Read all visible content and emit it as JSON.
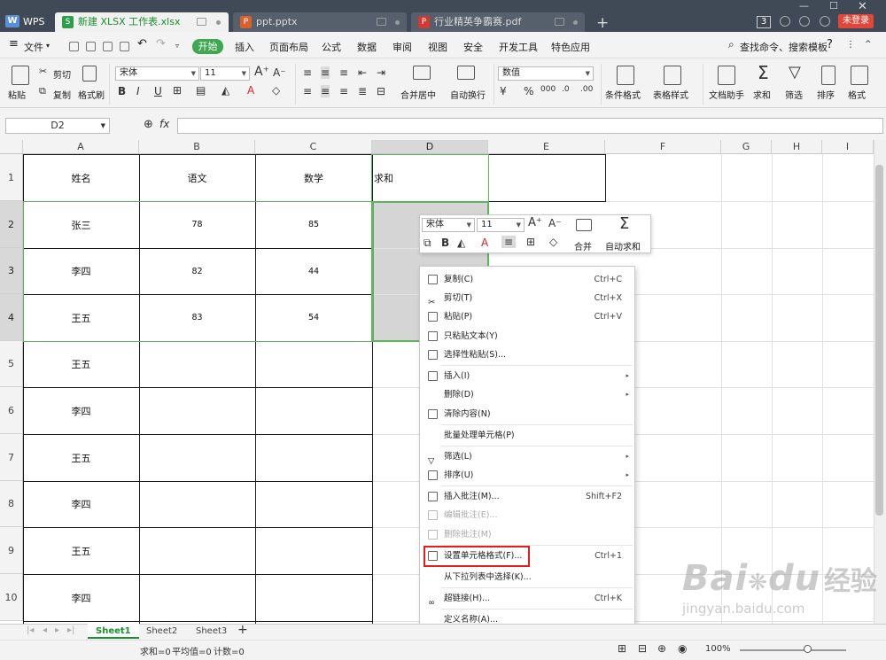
{
  "app": {
    "logo": "WPS",
    "tabs": [
      {
        "label": "新建 XLSX 工作表.xlsx",
        "active": true,
        "icon": "S"
      },
      {
        "label": "ppt.pptx",
        "active": false,
        "icon": "P"
      },
      {
        "label": "行业精英争霸赛.pdf",
        "active": false,
        "icon": "P"
      }
    ],
    "window_count": "3",
    "login_label": "未登录"
  },
  "menubar": {
    "file_label": "文件",
    "start_label": "开始",
    "items": [
      "插入",
      "页面布局",
      "公式",
      "数据",
      "审阅",
      "视图",
      "安全",
      "开发工具",
      "特色应用"
    ],
    "search_label": "查找命令、搜索模板",
    "help_label": "?"
  },
  "ribbon": {
    "paste": "粘贴",
    "cut": "剪切",
    "copy": "复制",
    "format_painter": "格式刷",
    "font_name": "宋体",
    "font_size": "11",
    "merge_center": "合并居中",
    "wrap_text": "自动换行",
    "number_format": "数值",
    "conditional_format": "条件格式",
    "table_style": "表格样式",
    "doc_helper": "文档助手",
    "sum": "求和",
    "filter": "筛选",
    "sort": "排序",
    "format": "格式"
  },
  "formula_bar": {
    "name_box": "D2",
    "fx": "fx",
    "value": ""
  },
  "columns": [
    "A",
    "B",
    "C",
    "D",
    "E",
    "F",
    "G",
    "H",
    "I"
  ],
  "rows": [
    "1",
    "2",
    "3",
    "4",
    "5",
    "6",
    "7",
    "8",
    "9",
    "10"
  ],
  "cells": {
    "A1": "姓名",
    "B1": "语文",
    "C1": "数学",
    "D1": "求和",
    "A2": "张三",
    "B2": "78",
    "C2": "85",
    "A3": "李四",
    "B3": "82",
    "C3": "44",
    "A4": "王五",
    "B4": "83",
    "C4": "54",
    "A5": "王五",
    "A6": "李四",
    "A7": "王五",
    "A8": "李四",
    "A9": "王五",
    "A10": "李四"
  },
  "mini_toolbar": {
    "font_name": "宋体",
    "font_size": "11",
    "merge": "合并",
    "autosum": "自动求和"
  },
  "context_menu": [
    {
      "label": "复制(C)",
      "shortcut": "Ctrl+C"
    },
    {
      "label": "剪切(T)",
      "shortcut": "Ctrl+X"
    },
    {
      "label": "粘贴(P)",
      "shortcut": "Ctrl+V"
    },
    {
      "label": "只粘贴文本(Y)",
      "shortcut": ""
    },
    {
      "label": "选择性粘贴(S)...",
      "shortcut": ""
    },
    {
      "label": "插入(I)",
      "shortcut": "",
      "submenu": true
    },
    {
      "label": "删除(D)",
      "shortcut": "",
      "submenu": true
    },
    {
      "label": "清除内容(N)",
      "shortcut": ""
    },
    {
      "label": "批量处理单元格(P)",
      "shortcut": ""
    },
    {
      "label": "筛选(L)",
      "shortcut": "",
      "submenu": true
    },
    {
      "label": "排序(U)",
      "shortcut": "",
      "submenu": true
    },
    {
      "label": "插入批注(M)...",
      "shortcut": "Shift+F2"
    },
    {
      "label": "编辑批注(E)...",
      "shortcut": "",
      "disabled": true
    },
    {
      "label": "删除批注(M)",
      "shortcut": "",
      "disabled": true
    },
    {
      "label": "设置单元格格式(F)...",
      "shortcut": "Ctrl+1",
      "highlighted": true
    },
    {
      "label": "从下拉列表中选择(K)...",
      "shortcut": ""
    },
    {
      "label": "超链接(H)...",
      "shortcut": "Ctrl+K"
    },
    {
      "label": "定义名称(A)...",
      "shortcut": ""
    }
  ],
  "sheets": [
    "Sheet1",
    "Sheet2",
    "Sheet3"
  ],
  "status": {
    "sum": "求和=0",
    "avg": "平均值=0",
    "count": "计数=0",
    "zoom": "100%"
  },
  "watermark": {
    "text": "Bai",
    "text2": "du",
    "cn": "经验",
    "url": "jingyan.baidu.com"
  },
  "colors": {
    "accent": "#3fa651",
    "selection": "#5fb35f",
    "highlight": "#e02020"
  }
}
